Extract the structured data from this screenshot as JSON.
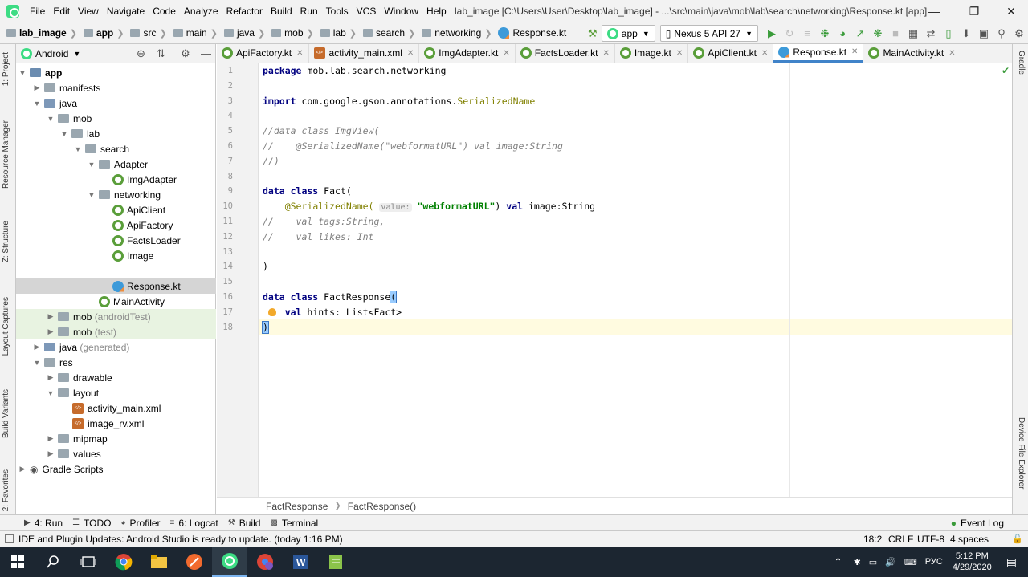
{
  "menubar": {
    "items": [
      "File",
      "Edit",
      "View",
      "Navigate",
      "Code",
      "Analyze",
      "Refactor",
      "Build",
      "Run",
      "Tools",
      "VCS",
      "Window",
      "Help"
    ],
    "window_title": "lab_image [C:\\Users\\User\\Desktop\\lab_image] - ...\\src\\main\\java\\mob\\lab\\search\\networking\\Response.kt [app]"
  },
  "breadcrumbs": [
    "lab_image",
    "app",
    "src",
    "main",
    "java",
    "mob",
    "lab",
    "search",
    "networking",
    "Response.kt"
  ],
  "toolbar": {
    "run_config": "app",
    "device": "Nexus 5 API 27"
  },
  "left_strip": [
    "1: Project",
    "Resource Manager",
    "Z: Structure",
    "Layout Captures",
    "Build Variants",
    "2: Favorites"
  ],
  "right_strip": [
    "Gradle",
    "Device File Explorer"
  ],
  "project_panel": {
    "view_mode": "Android",
    "tree": [
      {
        "label": "app",
        "bold": true
      },
      {
        "label": "manifests"
      },
      {
        "label": "java"
      },
      {
        "label": "mob"
      },
      {
        "label": "lab"
      },
      {
        "label": "search"
      },
      {
        "label": "Adapter"
      },
      {
        "label": "ImgAdapter"
      },
      {
        "label": "networking"
      },
      {
        "label": "ApiClient"
      },
      {
        "label": "ApiFactory"
      },
      {
        "label": "FactsLoader"
      },
      {
        "label": "Image"
      },
      {
        "label": "Response.kt"
      },
      {
        "label": "MainActivity"
      },
      {
        "label": "mob",
        "suffix": "(androidTest)"
      },
      {
        "label": "mob",
        "suffix": "(test)"
      },
      {
        "label": "java",
        "suffix": "(generated)"
      },
      {
        "label": "res"
      },
      {
        "label": "drawable"
      },
      {
        "label": "layout"
      },
      {
        "label": "activity_main.xml"
      },
      {
        "label": "image_rv.xml"
      },
      {
        "label": "mipmap"
      },
      {
        "label": "values"
      },
      {
        "label": "Gradle Scripts"
      }
    ]
  },
  "tabs": [
    "ApiFactory.kt",
    "activity_main.xml",
    "ImgAdapter.kt",
    "FactsLoader.kt",
    "Image.kt",
    "ApiClient.kt",
    "Response.kt",
    "MainActivity.kt"
  ],
  "active_tab": "Response.kt",
  "editor": {
    "line_numbers": [
      "1",
      "2",
      "3",
      "4",
      "5",
      "6",
      "7",
      "8",
      "9",
      "10",
      "11",
      "12",
      "13",
      "14",
      "15",
      "16",
      "17",
      "18"
    ],
    "l1_kw": "package",
    "l1_rest": " mob.lab.search.networking",
    "l3_kw": "import",
    "l3_rest": " com.google.gson.annotations.",
    "l3_an": "SerializedName",
    "l5": "//data class ImgView(",
    "l6": "//    @SerializedName(\"webformatURL\") val image:String",
    "l7": "//)",
    "l9_kw": "data class",
    "l9_rest": " Fact(",
    "l10_an": "@SerializedName(",
    "l10_hint": "value:",
    "l10_str": "\"webformatURL\"",
    "l10_mid": ") ",
    "l10_kw": "val",
    "l10_rest": " image:String",
    "l11": "//    val tags:String,",
    "l12": "//    val likes: Int",
    "l14": ")",
    "l16_kw": "data class",
    "l16_rest": " FactResponse",
    "l16_brk": "(",
    "l17_kw": "val",
    "l17_rest": " hints: List<Fact>",
    "l18": ")"
  },
  "editor_breadcrumb": [
    "FactResponse",
    "FactResponse()"
  ],
  "tool_windows": [
    "4: Run",
    "TODO",
    "Profiler",
    "6: Logcat",
    "Build",
    "Terminal"
  ],
  "event_log": "Event Log",
  "status": {
    "message": "IDE and Plugin Updates: Android Studio is ready to update. (today 1:16 PM)",
    "position": "18:2",
    "line_sep": "CRLF",
    "encoding": "UTF-8",
    "indent": "4 spaces"
  },
  "taskbar": {
    "lang": "РУС",
    "time": "5:12 PM",
    "date": "4/29/2020"
  },
  "colors": {
    "accent": "#4083c9",
    "keyword": "#000080",
    "string": "#008000",
    "annotation": "#808000",
    "comment": "#808080"
  }
}
